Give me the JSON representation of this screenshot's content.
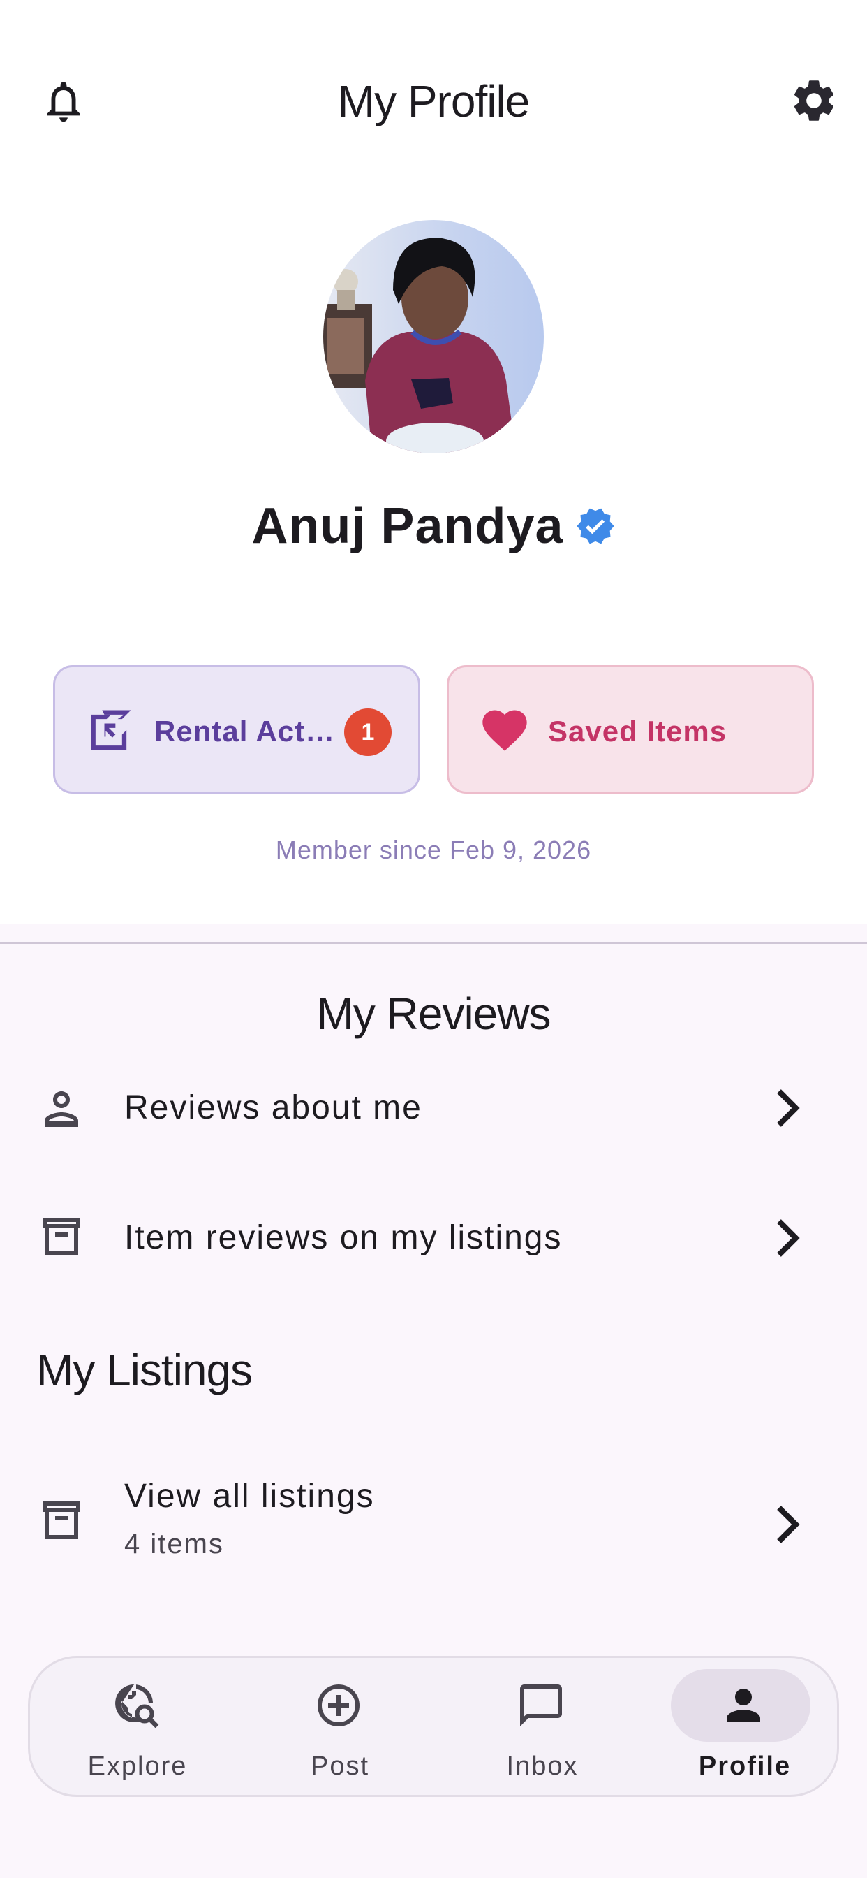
{
  "header": {
    "title": "My Profile",
    "bell_icon": "bell-icon",
    "settings_icon": "gear-icon"
  },
  "profile": {
    "name": "Anuj Pandya",
    "verified_icon": "verified-badge-icon",
    "member_since": "Member since Feb 9, 2026"
  },
  "actions": {
    "rental": {
      "label": "Rental Activity",
      "badge": "1",
      "icon": "rental-activity-icon"
    },
    "saved": {
      "label": "Saved Items",
      "icon": "heart-icon"
    }
  },
  "reviews": {
    "title": "My Reviews",
    "items": [
      {
        "label": "Reviews about me",
        "icon": "person-icon"
      },
      {
        "label": "Item reviews on my listings",
        "icon": "archive-box-icon"
      }
    ]
  },
  "listings": {
    "title": "My Listings",
    "view_all": {
      "label": "View all listings",
      "sub": "4 items",
      "icon": "archive-box-icon"
    }
  },
  "nav": {
    "items": [
      {
        "label": "Explore",
        "icon": "explore-globe-icon"
      },
      {
        "label": "Post",
        "icon": "add-circle-icon"
      },
      {
        "label": "Inbox",
        "icon": "chat-bubble-icon"
      },
      {
        "label": "Profile",
        "icon": "person-icon"
      }
    ],
    "active": "Profile"
  },
  "colors": {
    "rental_accent": "#5b3e9c",
    "saved_accent": "#c43466",
    "badge": "#e24a34",
    "verified": "#3f8ae8"
  }
}
